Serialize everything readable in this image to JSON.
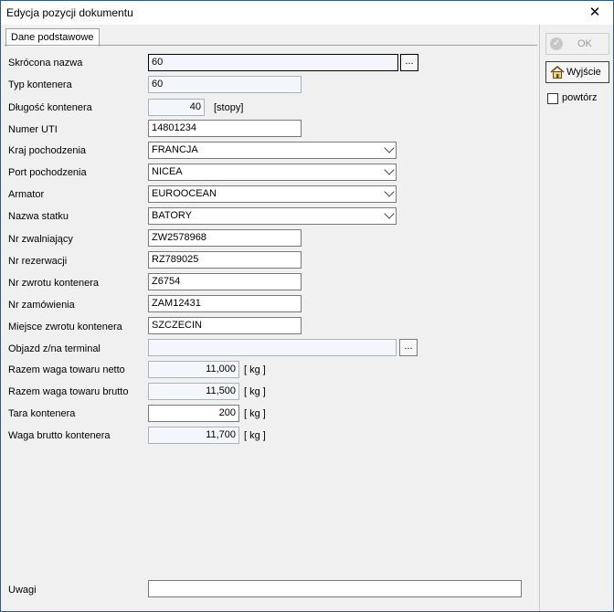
{
  "window": {
    "title": "Edycja pozycji dokumentu",
    "close_glyph": "✕"
  },
  "tab": {
    "label": "Dane podstawowe"
  },
  "fields": {
    "skrocona_nazwa": {
      "label": "Skrócona nazwa",
      "value": "60"
    },
    "typ_kontenera": {
      "label": "Typ kontenera",
      "value": "60"
    },
    "dlugosc_kontenera": {
      "label": "Długość kontenera",
      "value": "40",
      "unit": "[stopy]"
    },
    "numer_uti": {
      "label": "Numer UTI",
      "value": "14801234"
    },
    "kraj_pochodzenia": {
      "label": "Kraj pochodzenia",
      "value": "FRANCJA"
    },
    "port_pochodzenia": {
      "label": "Port pochodzenia",
      "value": "NICEA"
    },
    "armator": {
      "label": "Armator",
      "value": "EUROOCEAN"
    },
    "nazwa_statku": {
      "label": "Nazwa statku",
      "value": "BATORY"
    },
    "nr_zwalniajacy": {
      "label": "Nr zwalniający",
      "value": "ZW2578968"
    },
    "nr_rezerwacji": {
      "label": "Nr rezerwacji",
      "value": "RZ789025"
    },
    "nr_zwrotu_kontenera": {
      "label": "Nr zwrotu kontenera",
      "value": "Z6754"
    },
    "nr_zamowienia": {
      "label": "Nr zamówienia",
      "value": "ZAM12431"
    },
    "miejsce_zwrotu_kontenera": {
      "label": "Miejsce zwrotu kontenera",
      "value": "SZCZECIN"
    },
    "objazd_terminal": {
      "label": "Objazd z/na terminal",
      "value": ""
    },
    "razem_netto": {
      "label": "Razem waga towaru netto",
      "value": "11,000",
      "unit": "[ kg ]"
    },
    "razem_brutto": {
      "label": "Razem waga towaru brutto",
      "value": "11,500",
      "unit": "[ kg ]"
    },
    "tara_kontenera": {
      "label": "Tara kontenera",
      "value": "200",
      "unit": "[ kg ]"
    },
    "waga_brutto_kontenera": {
      "label": "Waga brutto kontenera",
      "value": "11,700",
      "unit": "[ kg ]"
    },
    "uwagi": {
      "label": "Uwagi",
      "value": ""
    }
  },
  "ellipsis": "...",
  "side": {
    "ok_label": "OK",
    "exit_label": "Wyjście",
    "repeat_label": "powtórz",
    "ok_icon": "check-circle-icon",
    "exit_icon": "home-icon"
  }
}
